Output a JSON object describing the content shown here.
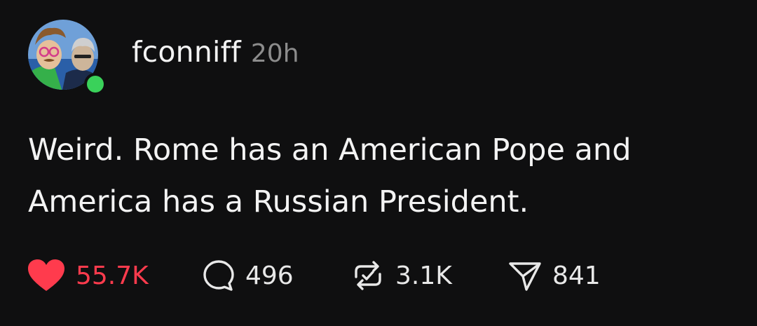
{
  "post": {
    "author": {
      "username": "fconniff",
      "online": true
    },
    "timestamp": "20h",
    "text_lines": [
      "Weird. Rome has an American Pope and",
      "America has a Russian President."
    ],
    "actions": {
      "like": {
        "icon": "heart-icon",
        "count": "55.7K",
        "active": true,
        "color": "#ff3b4d"
      },
      "reply": {
        "icon": "comment-icon",
        "count": "496"
      },
      "repost": {
        "icon": "repost-icon",
        "count": "3.1K"
      },
      "share": {
        "icon": "send-icon",
        "count": "841"
      }
    }
  },
  "colors": {
    "background": "#0f0f10",
    "text": "#f3f3f3",
    "muted": "#8c8c8c",
    "like": "#ff3b4d",
    "online": "#3ad15a"
  }
}
